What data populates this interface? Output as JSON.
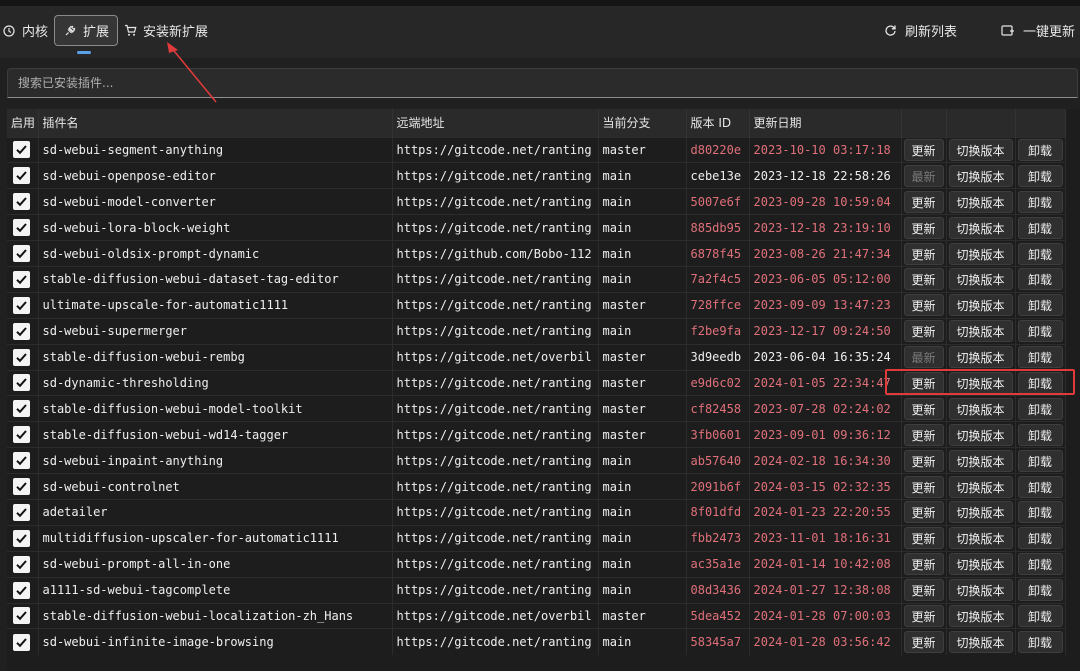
{
  "toolbar": {
    "tab_kernel": "内核",
    "tab_extensions": "扩展",
    "tab_install": "安装新扩展",
    "refresh": "刷新列表",
    "update_all": "一键更新"
  },
  "search": {
    "placeholder": "搜索已安装插件..."
  },
  "columns": {
    "enabled": "启用",
    "name": "插件名",
    "url": "远端地址",
    "branch": "当前分支",
    "version": "版本 ID",
    "date": "更新日期"
  },
  "buttons": {
    "update": "更新",
    "latest": "最新",
    "switch": "切换版本",
    "uninstall": "卸载"
  },
  "colors": {
    "accent": "#5aa0e6",
    "update_text": "#e0707a",
    "highlight": "#e03b3b"
  },
  "rows": [
    {
      "name": "sd-webui-segment-anything",
      "url": "https://gitcode.net/ranting",
      "branch": "master",
      "version": "d80220e",
      "date": "2023-10-10 03:17:18",
      "update": "更新"
    },
    {
      "name": "sd-webui-openpose-editor",
      "url": "https://gitcode.net/ranting",
      "branch": "main",
      "version": "cebe13e",
      "date": "2023-12-18 22:58:26",
      "update": "最新"
    },
    {
      "name": "sd-webui-model-converter",
      "url": "https://gitcode.net/ranting",
      "branch": "main",
      "version": "5007e6f",
      "date": "2023-09-28 10:59:04",
      "update": "更新"
    },
    {
      "name": "sd-webui-lora-block-weight",
      "url": "https://gitcode.net/ranting",
      "branch": "main",
      "version": "885db95",
      "date": "2023-12-18 23:19:10",
      "update": "更新"
    },
    {
      "name": "sd-webui-oldsix-prompt-dynamic",
      "url": "https://github.com/Bobo-112",
      "branch": "main",
      "version": "6878f45",
      "date": "2023-08-26 21:47:34",
      "update": "更新"
    },
    {
      "name": "stable-diffusion-webui-dataset-tag-editor",
      "url": "https://gitcode.net/ranting",
      "branch": "main",
      "version": "7a2f4c5",
      "date": "2023-06-05 05:12:00",
      "update": "更新"
    },
    {
      "name": "ultimate-upscale-for-automatic1111",
      "url": "https://gitcode.net/ranting",
      "branch": "master",
      "version": "728ffce",
      "date": "2023-09-09 13:47:23",
      "update": "更新"
    },
    {
      "name": "sd-webui-supermerger",
      "url": "https://gitcode.net/ranting",
      "branch": "main",
      "version": "f2be9fa",
      "date": "2023-12-17 09:24:50",
      "update": "更新"
    },
    {
      "name": "stable-diffusion-webui-rembg",
      "url": "https://gitcode.net/overbil",
      "branch": "master",
      "version": "3d9eedb",
      "date": "2023-06-04 16:35:24",
      "update": "最新"
    },
    {
      "name": "sd-dynamic-thresholding",
      "url": "https://gitcode.net/ranting",
      "branch": "master",
      "version": "e9d6c02",
      "date": "2024-01-05 22:34:47",
      "update": "更新"
    },
    {
      "name": "stable-diffusion-webui-model-toolkit",
      "url": "https://gitcode.net/ranting",
      "branch": "master",
      "version": "cf82458",
      "date": "2023-07-28 02:24:02",
      "update": "更新"
    },
    {
      "name": "stable-diffusion-webui-wd14-tagger",
      "url": "https://gitcode.net/ranting",
      "branch": "master",
      "version": "3fb0601",
      "date": "2023-09-01 09:36:12",
      "update": "更新"
    },
    {
      "name": "sd-webui-inpaint-anything",
      "url": "https://gitcode.net/ranting",
      "branch": "main",
      "version": "ab57640",
      "date": "2024-02-18 16:34:30",
      "update": "更新"
    },
    {
      "name": "sd-webui-controlnet",
      "url": "https://gitcode.net/ranting",
      "branch": "main",
      "version": "2091b6f",
      "date": "2024-03-15 02:32:35",
      "update": "更新"
    },
    {
      "name": "adetailer",
      "url": "https://gitcode.net/ranting",
      "branch": "main",
      "version": "8f01dfd",
      "date": "2024-01-23 22:20:55",
      "update": "更新"
    },
    {
      "name": "multidiffusion-upscaler-for-automatic1111",
      "url": "https://gitcode.net/ranting",
      "branch": "main",
      "version": "fbb2473",
      "date": "2023-11-01 18:16:31",
      "update": "更新"
    },
    {
      "name": "sd-webui-prompt-all-in-one",
      "url": "https://gitcode.net/ranting",
      "branch": "main",
      "version": "ac35a1e",
      "date": "2024-01-14 10:42:08",
      "update": "更新"
    },
    {
      "name": "a1111-sd-webui-tagcomplete",
      "url": "https://gitcode.net/ranting",
      "branch": "main",
      "version": "08d3436",
      "date": "2024-01-27 12:38:08",
      "update": "更新"
    },
    {
      "name": "stable-diffusion-webui-localization-zh_Hans",
      "url": "https://gitcode.net/overbil",
      "branch": "master",
      "version": "5dea452",
      "date": "2024-01-28 07:00:03",
      "update": "更新"
    },
    {
      "name": "sd-webui-infinite-image-browsing",
      "url": "https://gitcode.net/ranting",
      "branch": "main",
      "version": "58345a7",
      "date": "2024-01-28 03:56:42",
      "update": "更新"
    }
  ]
}
